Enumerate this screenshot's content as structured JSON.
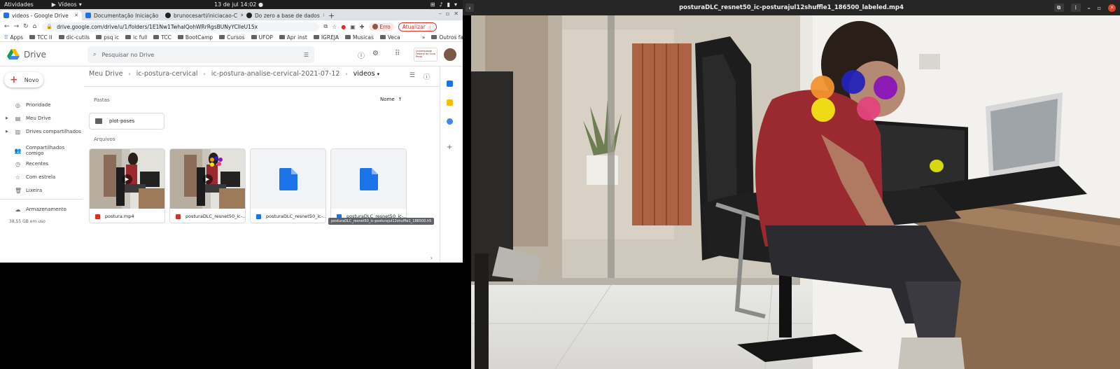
{
  "topbar": {
    "activities": "Atividades",
    "app_menu": "Vídeos",
    "clock": "13 de jul  14:02"
  },
  "browser": {
    "tabs": [
      {
        "title": "videos - Google Drive",
        "active": true,
        "icon_color": "#1a73e8"
      },
      {
        "title": "Documentação Iniciação",
        "active": false,
        "icon_color": "#1a73e8"
      },
      {
        "title": "brunocesarti/iniciacao-C",
        "active": false,
        "icon_color": "#202124"
      },
      {
        "title": "Do zero a base de dados",
        "active": false,
        "icon_color": "#202124"
      }
    ],
    "url": "drive.google.com/drive/u/1/folders/1E1Nw1TwhalQohWRrRgsBUNyYCIleU15x",
    "error_chip": "Erro",
    "update_chip": "Atualizar",
    "bookmarks": [
      "Apps",
      "TCC II",
      "dic-cutils",
      "psq ic",
      "ic full",
      "TCC",
      "BootCamp",
      "Cursos",
      "UFOP",
      "Apr inst",
      "IGREJA",
      "Musicas",
      "Veca"
    ],
    "other_bookmarks": "Outros favoritos"
  },
  "drive": {
    "app_name": "Drive",
    "search_placeholder": "Pesquisar no Drive",
    "org_logo_text": "Universidade Federal de Ouro Preto",
    "new_button": "Novo",
    "nav": [
      {
        "label": "Prioridade",
        "icon": "check-circle-icon",
        "expandable": false
      },
      {
        "label": "Meu Drive",
        "icon": "drive-icon",
        "expandable": true
      },
      {
        "label": "Drives compartilhados",
        "icon": "shared-drives-icon",
        "expandable": true
      },
      {
        "label": "Compartilhados comigo",
        "icon": "people-icon",
        "expandable": false
      },
      {
        "label": "Recentes",
        "icon": "clock-icon",
        "expandable": false
      },
      {
        "label": "Com estrela",
        "icon": "star-icon",
        "expandable": false
      },
      {
        "label": "Lixeira",
        "icon": "trash-icon",
        "expandable": false
      },
      {
        "label": "Armazenamento",
        "icon": "cloud-icon",
        "expandable": false
      }
    ],
    "storage_used": "38,55 GB em uso",
    "breadcrumb": [
      "Meu Drive",
      "ic-postura-cervical",
      "ic-postura-analise-cervical-2021-07-12",
      "videos"
    ],
    "section_folders": "Pastas",
    "sort_label": "Nome",
    "folders": [
      {
        "name": "plot-poses"
      }
    ],
    "section_files": "Arquivos",
    "files": [
      {
        "name": "postura.mp4",
        "type": "video",
        "icon_color": "#d93025"
      },
      {
        "name": "posturaDLC_resnet50_ic-...",
        "type": "video",
        "icon_color": "#d93025"
      },
      {
        "name": "posturaDLC_resnet50_ic-...",
        "type": "doc",
        "icon_color": "#1a73e8"
      },
      {
        "name": "posturaDLC_resnet50_ic-...",
        "type": "doc",
        "icon_color": "#1a73e8"
      }
    ],
    "tooltip": "posturaDLC_resnet50_ic-posturajul12shuffle1_186500.h5"
  },
  "player": {
    "title": "posturaDLC_resnet50_ic-posturajul12shuffle1_186500_labeled.mp4",
    "markers": [
      {
        "name": "marker-orange",
        "color": "#f0922e"
      },
      {
        "name": "marker-blue",
        "color": "#2323b8"
      },
      {
        "name": "marker-purple",
        "color": "#8a14b8"
      },
      {
        "name": "marker-yellow",
        "color": "#f2e414"
      },
      {
        "name": "marker-pink",
        "color": "#e0447a"
      }
    ]
  },
  "colors": {
    "google_blue": "#1a73e8",
    "google_red": "#d93025",
    "chrome_tabstrip": "#dee1e6",
    "player_titlebar": "#262626"
  }
}
